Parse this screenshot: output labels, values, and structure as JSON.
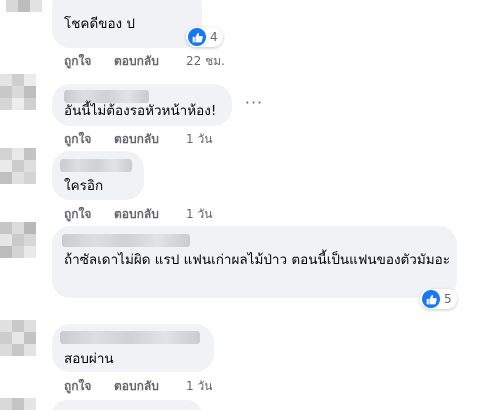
{
  "actions": {
    "like_label": "ถูกใจ",
    "reply_label": "ตอบกลับ"
  },
  "comments": [
    {
      "text": "โชคดีของ ป",
      "time": "22 ชม.",
      "reaction_count": "4"
    },
    {
      "text": "อันนี้ไม่ต้องรอหัวหน้าห้อง!",
      "time": "1 วัน"
    },
    {
      "text": "ใครอิก",
      "time": "1 วัน"
    },
    {
      "text": "ถ้าซัลเดาไม่ผิด แรป แฟนเก่าผลไม้ป่าว ตอนนี้เป็นแฟนของตัวมัมอะ",
      "reaction_count": "5"
    },
    {
      "text": "สอบผ่าน",
      "time": "1 วัน"
    }
  ],
  "colors": {
    "bubble": "#f0f2f5",
    "meta_text": "#65676b",
    "like_blue": "#1877f2"
  },
  "icons": {
    "like": "thumbs-up-icon",
    "more": "more-horizontal-icon"
  }
}
